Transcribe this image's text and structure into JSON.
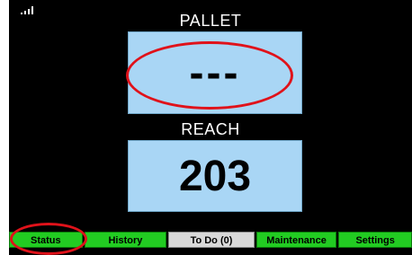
{
  "status_bar": {
    "signal_icon": "signal-strength-icon"
  },
  "pallet": {
    "label": "PALLET",
    "value": "---"
  },
  "reach": {
    "label": "REACH",
    "value": "203"
  },
  "nav": {
    "tabs": [
      {
        "label": "Status"
      },
      {
        "label": "History"
      },
      {
        "label": "To Do (0)",
        "selected": true
      },
      {
        "label": "Maintenance"
      },
      {
        "label": "Settings"
      }
    ]
  },
  "colors": {
    "screen_background": "#000000",
    "value_box": "#a9d6f5",
    "tab_green": "#22cc22",
    "tab_selected": "#d9d9d9",
    "annotation_red": "#e0121a"
  }
}
